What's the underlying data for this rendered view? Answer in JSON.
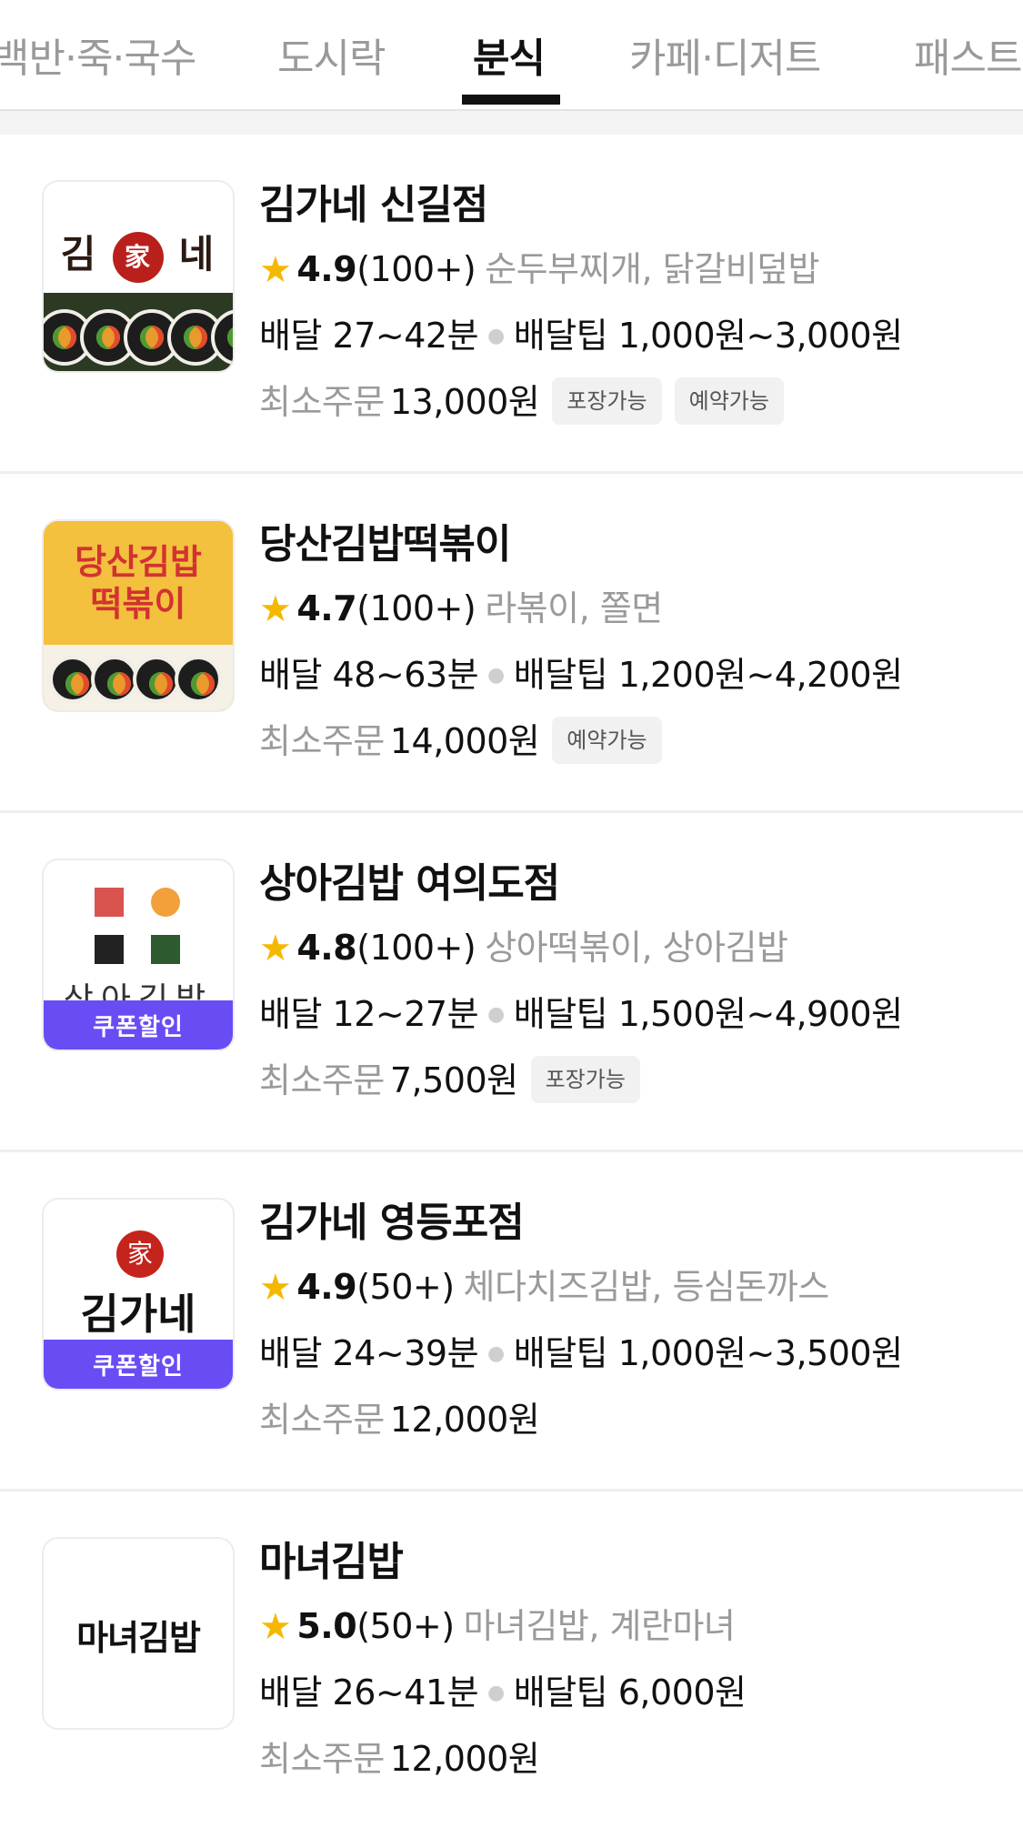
{
  "tabs": [
    {
      "label": "백반·죽·국수"
    },
    {
      "label": "도시락"
    },
    {
      "label": "분식"
    },
    {
      "label": "카페·디저트"
    },
    {
      "label": "패스트"
    }
  ],
  "active_tab": "분식",
  "colors": {
    "star": "#f5b800",
    "coupon": "#6a4cf5",
    "active_indicator": "#111111",
    "muted_text": "#9a9a9a"
  },
  "labels": {
    "delivery": "배달",
    "delivery_tip": "배달팁",
    "min_order": "최소주문",
    "coupon": "쿠폰할인"
  },
  "restaurants": [
    {
      "name": "김가네 신길점",
      "rating": "4.9",
      "reviews": "(100+)",
      "menu": "순두부찌개, 닭갈비덮밥",
      "delivery_time": "27~42분",
      "delivery_tip": "1,000원~3,000원",
      "min_order": "13,000원",
      "tags": [
        "포장가능",
        "예약가능"
      ],
      "coupon": false,
      "thumb_text": [
        "김",
        "家",
        "네"
      ]
    },
    {
      "name": "당산김밥떡볶이",
      "rating": "4.7",
      "reviews": "(100+)",
      "menu": "라볶이, 쫄면",
      "delivery_time": "48~63분",
      "delivery_tip": "1,200원~4,200원",
      "min_order": "14,000원",
      "tags": [
        "예약가능"
      ],
      "coupon": false,
      "thumb_text": [
        "당산김밥",
        "떡볶이"
      ]
    },
    {
      "name": "상아김밥 여의도점",
      "rating": "4.8",
      "reviews": "(100+)",
      "menu": "상아떡볶이, 상아김밥",
      "delivery_time": "12~27분",
      "delivery_tip": "1,500원~4,900원",
      "min_order": "7,500원",
      "tags": [
        "포장가능"
      ],
      "coupon": true,
      "thumb_text": [
        "상아김밥"
      ]
    },
    {
      "name": "김가네 영등포점",
      "rating": "4.9",
      "reviews": "(50+)",
      "menu": "체다치즈김밥, 등심돈까스",
      "delivery_time": "24~39분",
      "delivery_tip": "1,000원~3,500원",
      "min_order": "12,000원",
      "tags": [],
      "coupon": true,
      "thumb_text": [
        "家",
        "김가네"
      ]
    },
    {
      "name": "마녀김밥",
      "rating": "5.0",
      "reviews": "(50+)",
      "menu": "마녀김밥, 계란마녀",
      "delivery_time": "26~41분",
      "delivery_tip": "6,000원",
      "min_order": "12,000원",
      "tags": [],
      "coupon": false,
      "thumb_text": [
        "마녀김밥"
      ]
    }
  ]
}
